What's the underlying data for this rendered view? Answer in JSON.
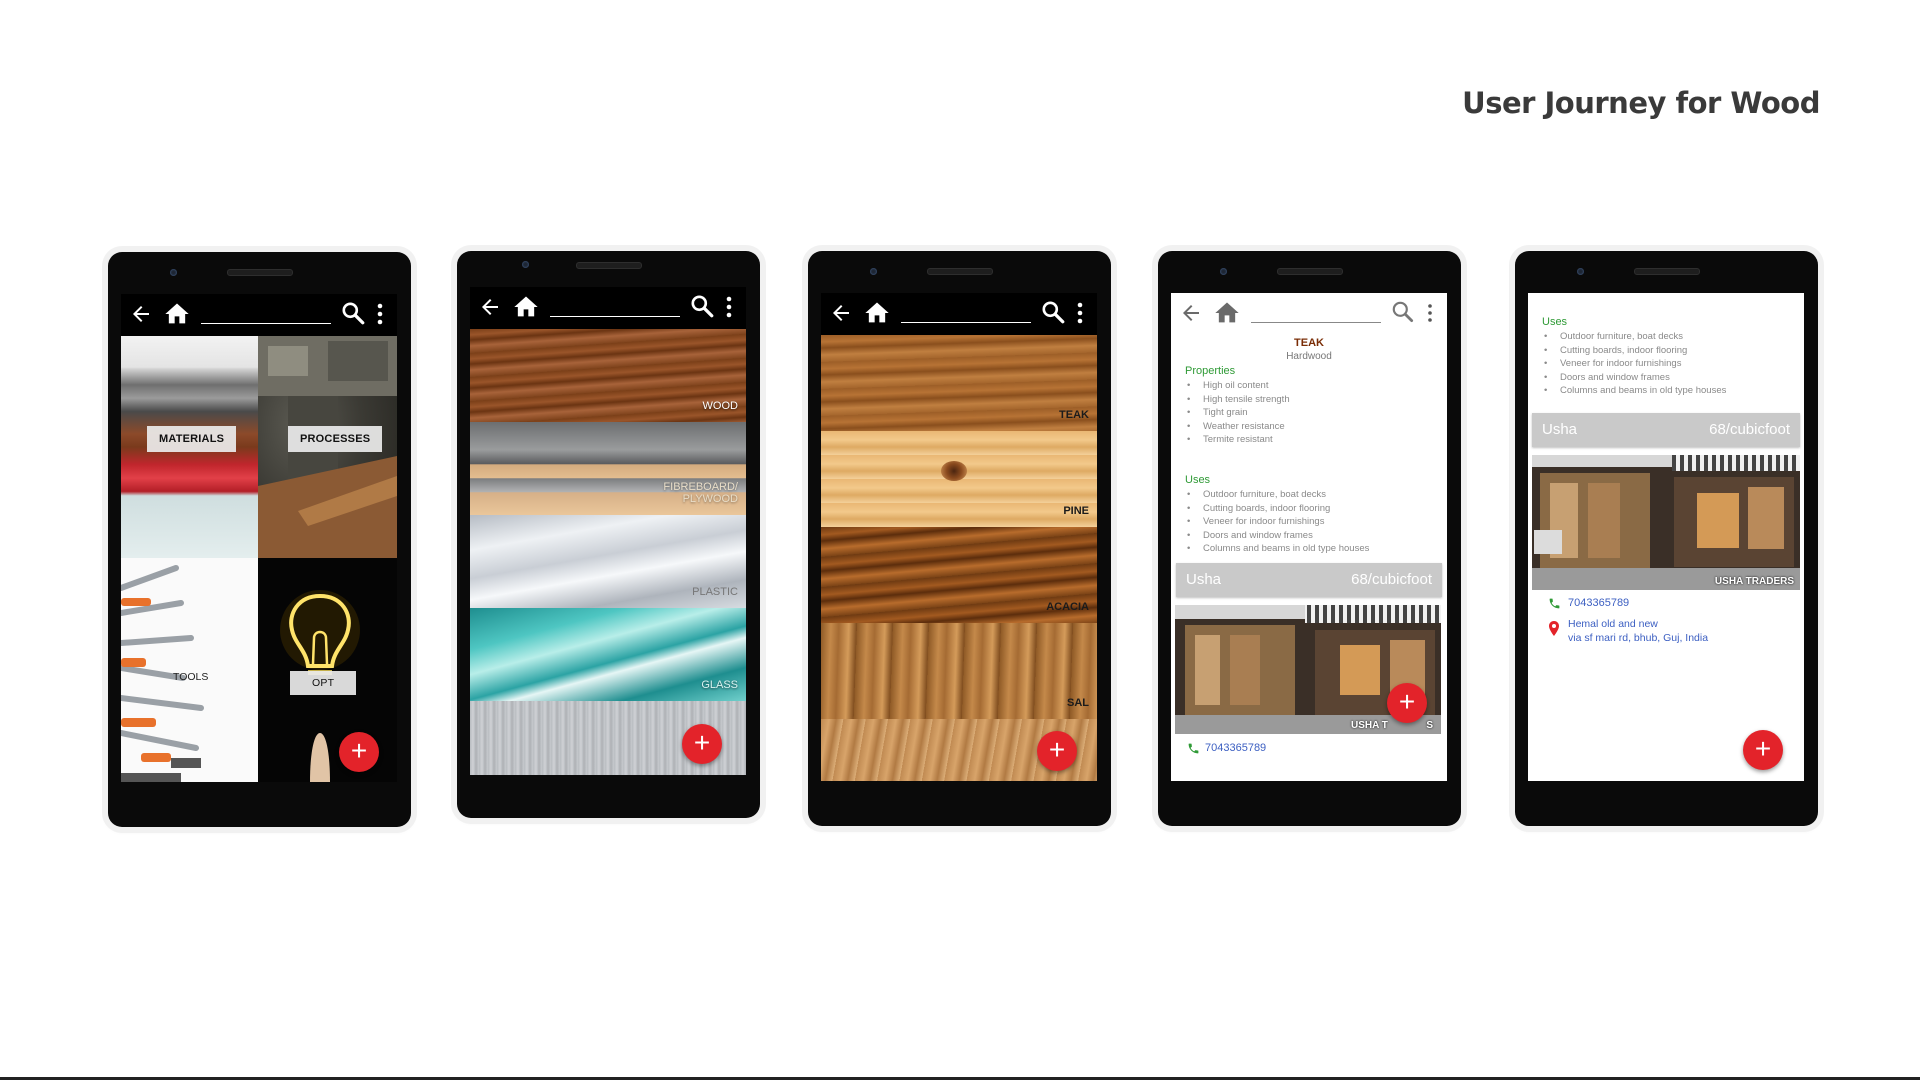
{
  "slide": {
    "title": "User Journey for Wood"
  },
  "icons": {
    "back": "arrow-left-icon",
    "home": "home-icon",
    "search": "magnifier-icon",
    "menu": "vertical-dots-icon",
    "add": "plus-icon",
    "phone": "phone-icon",
    "location": "location-pin-icon"
  },
  "colors": {
    "fab": "#e3232a",
    "section_heading": "#2f9a36",
    "contact_link": "#3c5fc2",
    "vendor_bar": "#c9c9c9"
  },
  "screen1": {
    "tiles": [
      {
        "label": "MATERIALS"
      },
      {
        "label": "PROCESSES"
      },
      {
        "label": "TOOLS"
      },
      {
        "label": "OPT"
      }
    ],
    "fab": "+"
  },
  "screen2": {
    "materials": [
      {
        "label": "WOOD"
      },
      {
        "label": "FIBREBOARD/ PLYWOOD"
      },
      {
        "label": "PLASTIC"
      },
      {
        "label": "GLASS"
      }
    ],
    "fab": "+"
  },
  "screen3": {
    "woods": [
      {
        "label": "TEAK"
      },
      {
        "label": "PINE"
      },
      {
        "label": "ACACIA"
      },
      {
        "label": "SAL"
      }
    ],
    "fab": "+"
  },
  "screen4": {
    "title": "TEAK",
    "subtitle": "Hardwood",
    "properties_heading": "Properties",
    "properties": [
      "High oil content",
      "High tensile strength",
      "Tight grain",
      "Weather resistance",
      "Termite resistant"
    ],
    "uses_heading": "Uses",
    "uses": [
      "Outdoor furniture, boat decks",
      "Cutting boards, indoor flooring",
      "Veneer for indoor furnishings",
      "Doors and window frames",
      "Columns and beams in old type houses"
    ],
    "vendor": {
      "name": "Usha",
      "price": "68/cubicfoot"
    },
    "shop_sign": "USHA T",
    "shop_sign_tail": "S",
    "phone": "7043365789",
    "fab": "+"
  },
  "screen5": {
    "uses_heading": "Uses",
    "uses": [
      "Outdoor furniture, boat decks",
      "Cutting boards, indoor flooring",
      "Veneer for indoor furnishings",
      "Doors and window frames",
      "Columns and beams in old type houses"
    ],
    "vendor": {
      "name": "Usha",
      "price": "68/cubicfoot"
    },
    "shop_sign": "USHA TRADERS",
    "phone": "7043365789",
    "address_line1": "Hemal old and new",
    "address_line2": "via sf mari rd, bhub, Guj, India",
    "fab": "+"
  }
}
